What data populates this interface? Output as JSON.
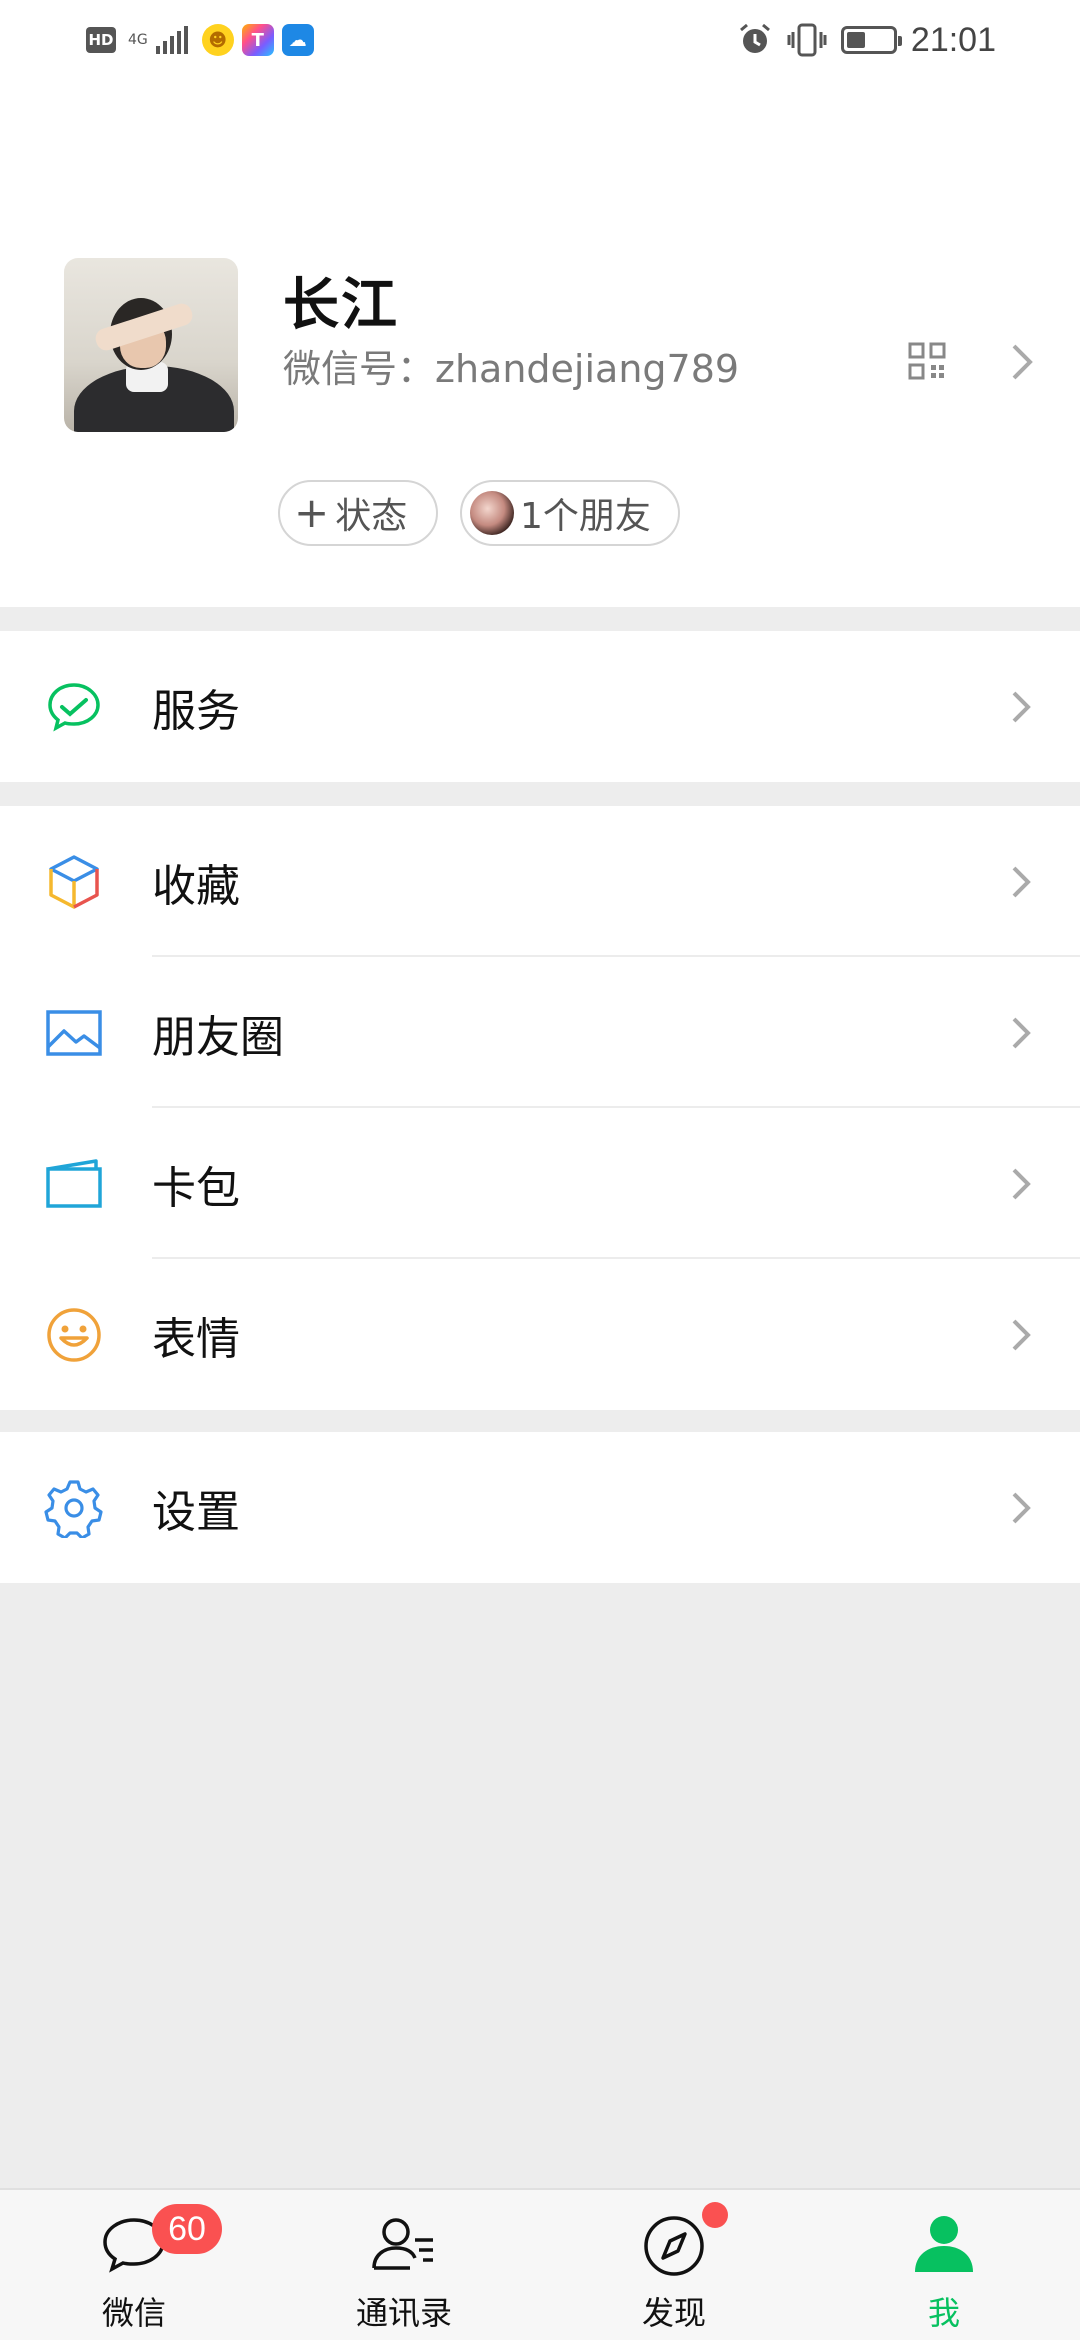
{
  "status_bar": {
    "network_hd": "HD",
    "network_type": "4G",
    "time": "21:01",
    "battery_level": 0.4
  },
  "profile": {
    "nickname": "长江",
    "wechat_id_label": "微信号：",
    "wechat_id": "zhandejiang789",
    "status_chip": "状态",
    "status_plus": "+",
    "friends_chip": "1个朋友"
  },
  "menu": {
    "services": {
      "label": "服务",
      "icon": "wechat-pay-check-icon"
    },
    "favorites": {
      "label": "收藏",
      "icon": "cube-icon"
    },
    "moments": {
      "label": "朋友圈",
      "icon": "image-icon"
    },
    "cards": {
      "label": "卡包",
      "icon": "wallet-card-icon"
    },
    "stickers": {
      "label": "表情",
      "icon": "smiley-icon"
    },
    "settings": {
      "label": "设置",
      "icon": "gear-icon"
    }
  },
  "tabbar": {
    "chats": {
      "label": "微信",
      "badge": "60"
    },
    "contacts": {
      "label": "通讯录"
    },
    "discover": {
      "label": "发现",
      "has_dot": true
    },
    "me": {
      "label": "我",
      "active": true
    }
  },
  "colors": {
    "accent_green": "#07c160",
    "badge_red": "#fa5151",
    "background": "#ededed"
  }
}
